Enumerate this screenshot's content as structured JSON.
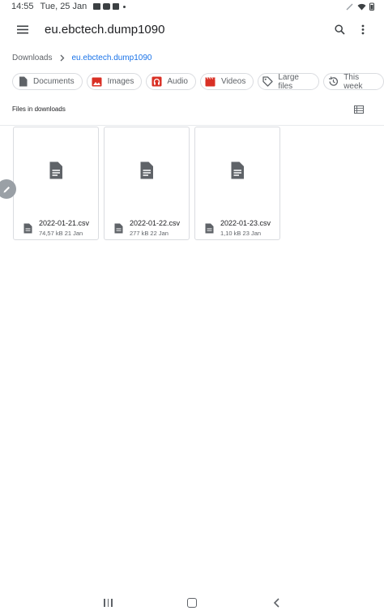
{
  "status_bar": {
    "time": "14:55",
    "date": "Tue, 25 Jan"
  },
  "app_bar": {
    "title": "eu.ebctech.dump1090",
    "menu_icon": "hamburger-menu-icon",
    "search_icon": "search-icon",
    "more_icon": "more-vert-icon"
  },
  "breadcrumb": {
    "root": "Downloads",
    "current": "eu.ebctech.dump1090"
  },
  "chips": [
    {
      "label": "Documents",
      "icon": "document-icon",
      "color": "#5f6368"
    },
    {
      "label": "Images",
      "icon": "image-icon",
      "color": "#d93025"
    },
    {
      "label": "Audio",
      "icon": "audio-icon",
      "color": "#d93025"
    },
    {
      "label": "Videos",
      "icon": "video-icon",
      "color": "#d93025"
    },
    {
      "label": "Large files",
      "icon": "tag-icon",
      "color": "#5f6368"
    },
    {
      "label": "This week",
      "icon": "history-icon",
      "color": "#5f6368"
    }
  ],
  "section": {
    "title": "Files in downloads",
    "view_icon": "list-view-icon"
  },
  "files": [
    {
      "name": "2022-01-21.csv",
      "detail": "74,57 kB 21 Jan"
    },
    {
      "name": "2022-01-22.csv",
      "detail": "277 kB 22 Jan"
    },
    {
      "name": "2022-01-23.csv",
      "detail": "1,10 kB 23 Jan"
    }
  ],
  "colors": {
    "accent": "#1a73e8",
    "icon_gray": "#5f6368",
    "chip_red": "#d93025",
    "border": "#dadce0"
  }
}
